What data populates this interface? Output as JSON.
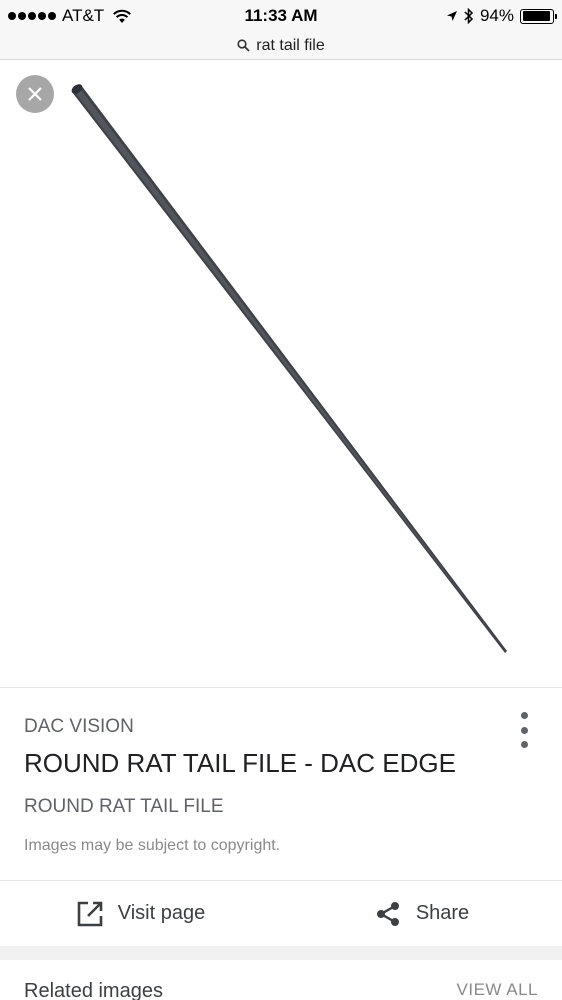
{
  "status_bar": {
    "carrier": "AT&T",
    "time": "11:33 AM",
    "battery": "94%",
    "battery_level": 0.94
  },
  "url_bar": {
    "query": "rat tail file"
  },
  "result": {
    "source": "DAC VISION",
    "title": "ROUND RAT TAIL FILE - DAC EDGE",
    "subtitle": "ROUND RAT TAIL FILE",
    "copyright": "Images may be subject to copyright."
  },
  "actions": {
    "visit_label": "Visit page",
    "share_label": "Share"
  },
  "related": {
    "title": "Related images",
    "view_all": "VIEW ALL"
  },
  "icons": {
    "close": "close-icon",
    "more": "more-vert-icon",
    "visit": "open-in-new-icon",
    "share": "share-icon",
    "search": "search-icon",
    "wifi": "wifi-icon",
    "location": "location-arrow-icon",
    "bluetooth": "bluetooth-icon",
    "battery": "battery-icon"
  }
}
